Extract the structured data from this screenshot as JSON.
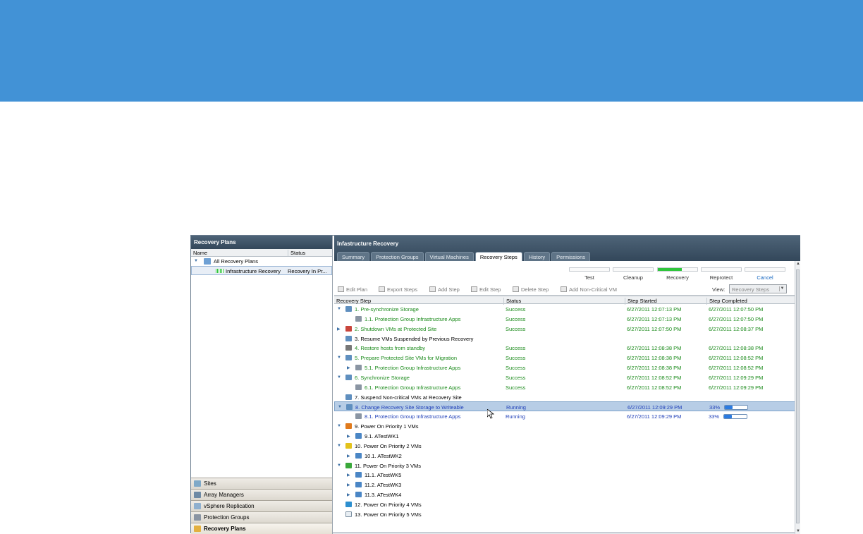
{
  "colors": {
    "banner": "#4292d6",
    "header": "#3d5368",
    "success": "#1a8a1a",
    "running": "#1f3fb8",
    "selection": "#b7cde6"
  },
  "left": {
    "title": "Recovery Plans",
    "columns": [
      "Name",
      "Status"
    ],
    "tree": [
      {
        "label": "All Recovery Plans",
        "status": ""
      },
      {
        "label": "Infrastructure Recovery",
        "status": "Recovery In Pr..."
      }
    ],
    "nav": [
      {
        "label": "Sites",
        "icon": "sites-icon",
        "color": "#7fa9c8"
      },
      {
        "label": "Array Managers",
        "icon": "array-managers-icon",
        "color": "#6e8aa5"
      },
      {
        "label": "vSphere Replication",
        "icon": "replication-icon",
        "color": "#8fb0cf"
      },
      {
        "label": "Protection Groups",
        "icon": "shield-icon",
        "color": "#8a95a3"
      },
      {
        "label": "Recovery Plans",
        "icon": "recovery-plans-icon",
        "color": "#e3b040",
        "active": true
      }
    ]
  },
  "right": {
    "title": "Infastructure Recovery",
    "tabs": [
      "Summary",
      "Protection Groups",
      "Virtual Machines",
      "Recovery Steps",
      "History",
      "Permissions"
    ],
    "active_tab": "Recovery Steps",
    "phases": [
      {
        "label": "Test",
        "fill": 0
      },
      {
        "label": "Cleanup",
        "fill": 0
      },
      {
        "label": "Recovery",
        "fill": 0.6
      },
      {
        "label": "Reprotect",
        "fill": 0
      },
      {
        "label": "Cancel",
        "fill": 0,
        "link": true
      }
    ],
    "toolbar": [
      "Edit Plan",
      "Export Steps",
      "Add Step",
      "Edit Step",
      "Delete Step",
      "Add Non-Critical VM"
    ],
    "view_label": "View:",
    "view_value": "Recovery Steps",
    "grid_columns": [
      "Recovery Step",
      "Status",
      "Step Started",
      "Step Completed"
    ],
    "steps": [
      {
        "level": 0,
        "exp": "▼",
        "label": "1. Pre-synchronize Storage",
        "status": "Success",
        "start": "6/27/2011 12:07:13 PM",
        "end": "6/27/2011 12:07:50 PM",
        "icon_color": "#5f8fbf"
      },
      {
        "level": 1,
        "exp": "",
        "label": "1.1. Protection Group Infrastructure Apps",
        "status": "Success",
        "start": "6/27/2011 12:07:13 PM",
        "end": "6/27/2011 12:07:50 PM",
        "icon_color": "#8a95a3"
      },
      {
        "level": 0,
        "exp": "▶",
        "label": "2. Shutdown VMs at Protected Site",
        "status": "Success",
        "start": "6/27/2011 12:07:50 PM",
        "end": "6/27/2011 12:08:37 PM",
        "icon_color": "#c9453c"
      },
      {
        "level": 0,
        "exp": "",
        "label": "3. Resume VMs Suspended by Previous Recovery",
        "status": "",
        "start": "",
        "end": "",
        "icon_color": "#5f8fbf"
      },
      {
        "level": 0,
        "exp": "",
        "label": "4. Restore hosts from standby",
        "status": "Success",
        "start": "6/27/2011 12:08:38 PM",
        "end": "6/27/2011 12:08:38 PM",
        "icon_color": "#777777"
      },
      {
        "level": 0,
        "exp": "▼",
        "label": "5. Prepare Protected Site VMs for Migration",
        "status": "Success",
        "start": "6/27/2011 12:08:38 PM",
        "end": "6/27/2011 12:08:52 PM",
        "icon_color": "#5f8fbf"
      },
      {
        "level": 1,
        "exp": "▶",
        "label": "5.1. Protection Group Infrastructure Apps",
        "status": "Success",
        "start": "6/27/2011 12:08:38 PM",
        "end": "6/27/2011 12:08:52 PM",
        "icon_color": "#8a95a3"
      },
      {
        "level": 0,
        "exp": "▼",
        "label": "6. Synchronize Storage",
        "status": "Success",
        "start": "6/27/2011 12:08:52 PM",
        "end": "6/27/2011 12:09:29 PM",
        "icon_color": "#5f8fbf"
      },
      {
        "level": 1,
        "exp": "",
        "label": "6.1. Protection Group Infrastructure Apps",
        "status": "Success",
        "start": "6/27/2011 12:08:52 PM",
        "end": "6/27/2011 12:09:29 PM",
        "icon_color": "#8a95a3"
      },
      {
        "level": 0,
        "exp": "",
        "label": "7. Suspend Non-critical VMs at Recovery Site",
        "status": "",
        "start": "",
        "end": "",
        "icon_color": "#5f8fbf"
      },
      {
        "level": 0,
        "exp": "▼",
        "label": "8. Change Recovery Site Storage to Writeable",
        "status": "Running",
        "start": "6/27/2011 12:09:29 PM",
        "end": "33%",
        "progress": 0.33,
        "selected": true,
        "icon_color": "#5f8fbf"
      },
      {
        "level": 1,
        "exp": "",
        "label": "8.1. Protection Group Infrastructure Apps",
        "status": "Running",
        "start": "6/27/2011 12:09:29 PM",
        "end": "33%",
        "progress": 0.33,
        "icon_color": "#8a95a3"
      },
      {
        "level": 0,
        "exp": "▼",
        "label": "9. Power On Priority 1 VMs",
        "status": "",
        "start": "",
        "end": "",
        "icon_color": "#e07a1c"
      },
      {
        "level": 1,
        "exp": "▶",
        "label": "9.1. ATestWK1",
        "status": "",
        "start": "",
        "end": "",
        "icon_color": "#4a86c5"
      },
      {
        "level": 0,
        "exp": "▼",
        "label": "10. Power On Priority 2 VMs",
        "status": "",
        "start": "",
        "end": "",
        "icon_color": "#e3c21b"
      },
      {
        "level": 1,
        "exp": "▶",
        "label": "10.1. ATestWK2",
        "status": "",
        "start": "",
        "end": "",
        "icon_color": "#4a86c5"
      },
      {
        "level": 0,
        "exp": "▼",
        "label": "11. Power On Priority 3 VMs",
        "status": "",
        "start": "",
        "end": "",
        "icon_color": "#3aa83a"
      },
      {
        "level": 1,
        "exp": "▶",
        "label": "11.1. ATestWK5",
        "status": "",
        "start": "",
        "end": "",
        "icon_color": "#4a86c5"
      },
      {
        "level": 1,
        "exp": "▶",
        "label": "11.2. ATestWK3",
        "status": "",
        "start": "",
        "end": "",
        "icon_color": "#4a86c5"
      },
      {
        "level": 1,
        "exp": "▶",
        "label": "11.3. ATestWK4",
        "status": "",
        "start": "",
        "end": "",
        "icon_color": "#4a86c5"
      },
      {
        "level": 0,
        "exp": "",
        "label": "12. Power On Priority 4 VMs",
        "status": "",
        "start": "",
        "end": "",
        "icon_color": "#2d8fcf"
      },
      {
        "level": 0,
        "exp": "",
        "label": "13. Power On Priority 5 VMs",
        "status": "",
        "start": "",
        "end": "",
        "icon_color": "#e8eef3"
      }
    ]
  }
}
